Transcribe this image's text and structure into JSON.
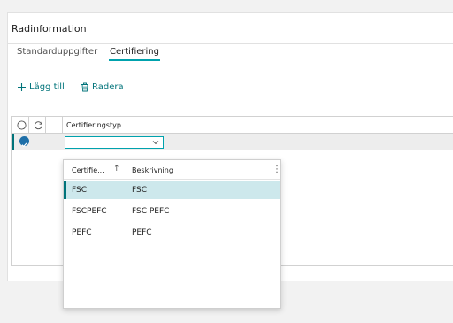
{
  "panel": {
    "title": "Radinformation"
  },
  "tabs": [
    {
      "label": "Standarduppgifter",
      "active": false
    },
    {
      "label": "Certifiering",
      "active": true
    }
  ],
  "actions": {
    "add_label": "Lägg till",
    "delete_label": "Radera"
  },
  "grid": {
    "column_title": "Certifieringstyp",
    "current_value": ""
  },
  "dropdown": {
    "headers": {
      "code": "Certifie...",
      "sort_indicator": "↑",
      "description": "Beskrivning",
      "menu": "⋮"
    },
    "rows": [
      {
        "code": "FSC",
        "description": "FSC",
        "selected": true
      },
      {
        "code": "FSCPEFC",
        "description": "FSC PEFC",
        "selected": false
      },
      {
        "code": "PEFC",
        "description": "PEFC",
        "selected": false
      }
    ]
  },
  "colors": {
    "accent": "#00a2ad",
    "action_text": "#00737a",
    "selected_row": "#cde8ec",
    "check_blue": "#1e6fa8"
  },
  "icons": {
    "add": "plus-icon",
    "delete": "trash-icon",
    "select_all": "circle-icon",
    "refresh": "refresh-icon",
    "row_check": "check-circle-icon",
    "dropdown_arrow": "chevron-down-icon",
    "sort": "arrow-up-icon",
    "more": "more-vertical-icon"
  }
}
